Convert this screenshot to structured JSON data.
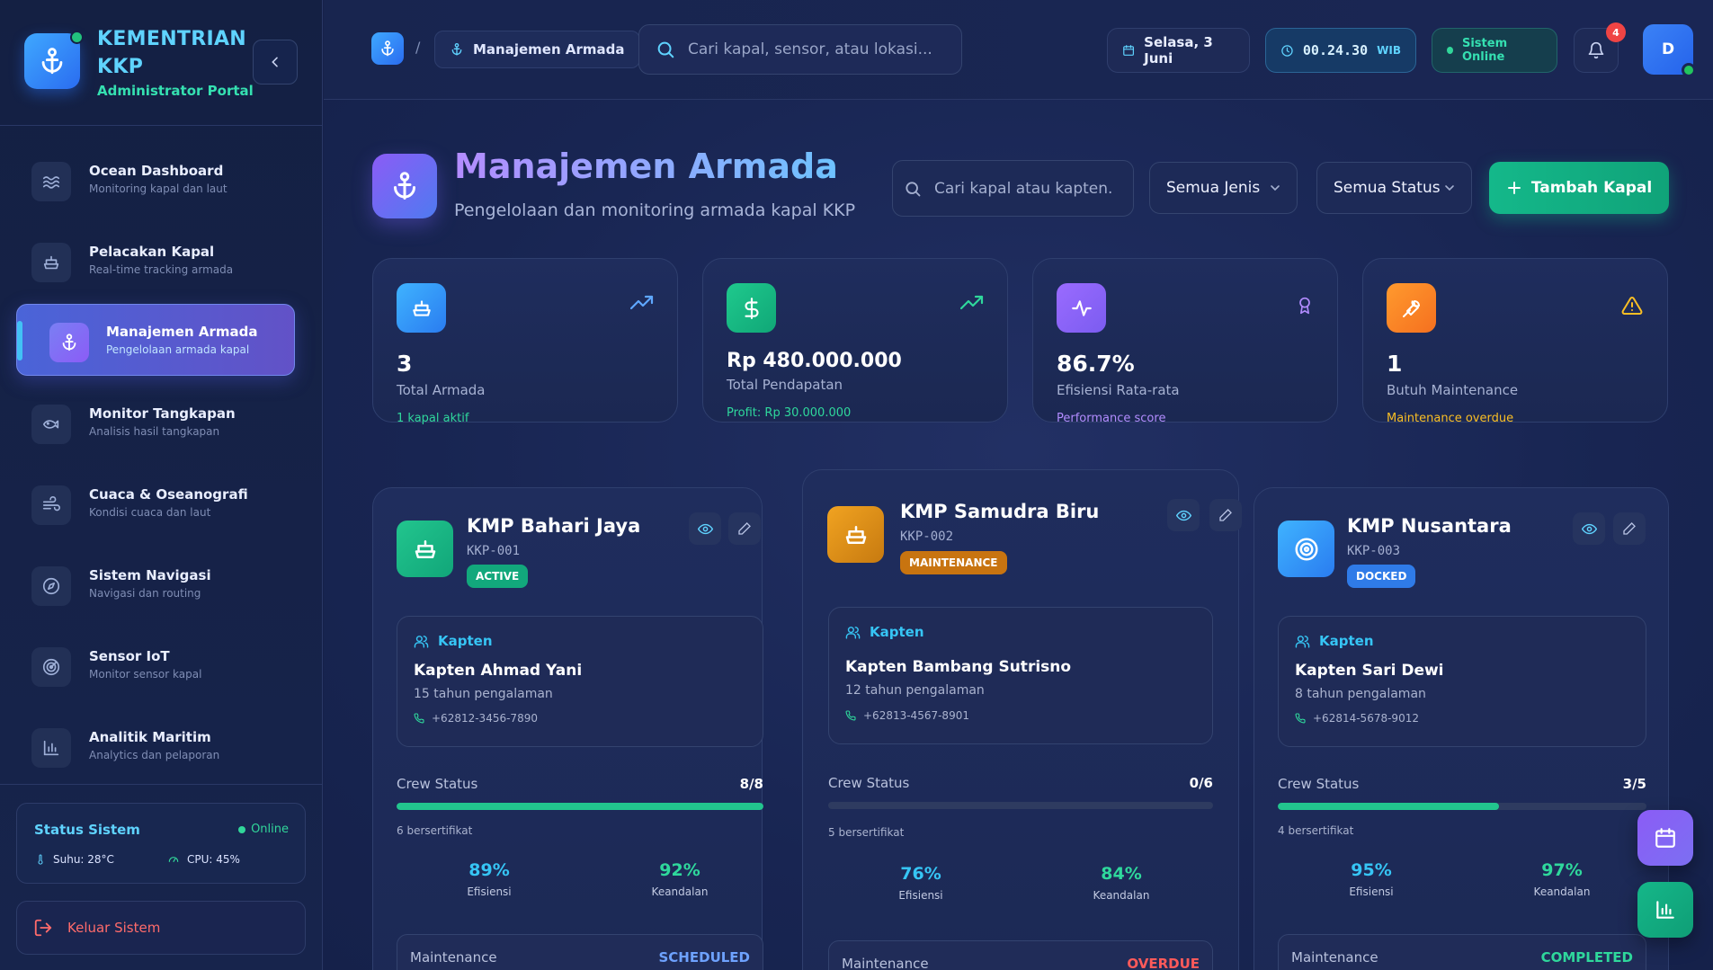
{
  "brand": {
    "title": "KEMENTRIAN KKP",
    "subtitle": "Administrator Portal"
  },
  "nav": [
    {
      "title": "Ocean Dashboard",
      "sub": "Monitoring kapal dan laut",
      "icon": "waves-icon"
    },
    {
      "title": "Pelacakan Kapal",
      "sub": "Real-time tracking armada",
      "icon": "ship-icon"
    },
    {
      "title": "Manajemen Armada",
      "sub": "Pengelolaan armada kapal",
      "icon": "anchor-icon",
      "active": true
    },
    {
      "title": "Monitor Tangkapan",
      "sub": "Analisis hasil tangkapan",
      "icon": "fish-icon"
    },
    {
      "title": "Cuaca & Oseanografi",
      "sub": "Kondisi cuaca dan laut",
      "icon": "wind-icon"
    },
    {
      "title": "Sistem Navigasi",
      "sub": "Navigasi dan routing",
      "icon": "compass-icon"
    },
    {
      "title": "Sensor IoT",
      "sub": "Monitor sensor kapal",
      "icon": "radar-icon"
    },
    {
      "title": "Analitik Maritim",
      "sub": "Analytics dan pelaporan",
      "icon": "bar-chart-icon"
    }
  ],
  "system": {
    "title": "Status Sistem",
    "status": "Online",
    "temp": "Suhu: 28°C",
    "cpu": "CPU: 45%"
  },
  "logout": "Keluar Sistem",
  "topbar": {
    "crumb": "Manajemen Armada",
    "separator": "/",
    "search_placeholder": "Cari kapal, sensor, atau lokasi...",
    "date": "Selasa, 3 Juni",
    "time": "00.24.30",
    "tz": "WIB",
    "online": "Sistem Online",
    "notif_count": "4",
    "avatar": "D"
  },
  "page": {
    "title": "Manajemen Armada",
    "subtitle": "Pengelolaan dan monitoring armada kapal KKP",
    "search_placeholder": "Cari kapal atau kapten..",
    "type_filter": "Semua Jenis",
    "status_filter": "Semua Status",
    "add_label": "Tambah Kapal"
  },
  "stats": [
    {
      "value": "3",
      "label": "Total Armada",
      "note": "1 kapal aktif",
      "note_color": "#2fd89c"
    },
    {
      "value": "Rp 480.000.000",
      "label": "Total Pendapatan",
      "note": "Profit: Rp 30.000.000",
      "note_color": "#2fd89c"
    },
    {
      "value": "86.7%",
      "label": "Efisiensi Rata-rata",
      "note": "Performance score",
      "note_color": "#b28cff"
    },
    {
      "value": "1",
      "label": "Butuh Maintenance",
      "note": "Maintenance overdue",
      "note_color": "#fbbf24"
    }
  ],
  "ships": [
    {
      "name": "KMP Bahari Jaya",
      "code": "KKP-001",
      "status": "ACTIVE",
      "captain_label": "Kapten",
      "captain": "Kapten Ahmad Yani",
      "experience": "15 tahun pengalaman",
      "phone": "+62812-3456-7890",
      "crew_label": "Crew Status",
      "crew": "8/8",
      "crew_fraction": 1.0,
      "certified": "6 bersertifikat",
      "efficiency": "89%",
      "efficiency_label": "Efisiensi",
      "reliability": "92%",
      "reliability_label": "Keandalan",
      "maint_label": "Maintenance",
      "maint_status": "SCHEDULED"
    },
    {
      "name": "KMP Samudra Biru",
      "code": "KKP-002",
      "status": "MAINTENANCE",
      "captain_label": "Kapten",
      "captain": "Kapten Bambang Sutrisno",
      "experience": "12 tahun pengalaman",
      "phone": "+62813-4567-8901",
      "crew_label": "Crew Status",
      "crew": "0/6",
      "crew_fraction": 0.0,
      "certified": "5 bersertifikat",
      "efficiency": "76%",
      "efficiency_label": "Efisiensi",
      "reliability": "84%",
      "reliability_label": "Keandalan",
      "maint_label": "Maintenance",
      "maint_status": "OVERDUE"
    },
    {
      "name": "KMP Nusantara",
      "code": "KKP-003",
      "status": "DOCKED",
      "captain_label": "Kapten",
      "captain": "Kapten Sari Dewi",
      "experience": "8 tahun pengalaman",
      "phone": "+62814-5678-9012",
      "crew_label": "Crew Status",
      "crew": "3/5",
      "crew_fraction": 0.6,
      "certified": "4 bersertifikat",
      "efficiency": "95%",
      "efficiency_label": "Efisiensi",
      "reliability": "97%",
      "reliability_label": "Keandalan",
      "maint_label": "Maintenance",
      "maint_status": "COMPLETED"
    }
  ],
  "colors": {
    "active": "#12a87c",
    "maintenance": "#c87410",
    "docked": "#2f7be8",
    "scheduled": "#6ea2ff",
    "overdue": "#ff5a5a",
    "completed": "#2fd89c",
    "efficiency": "#36c5f5",
    "reliability": "#2fd89c"
  }
}
